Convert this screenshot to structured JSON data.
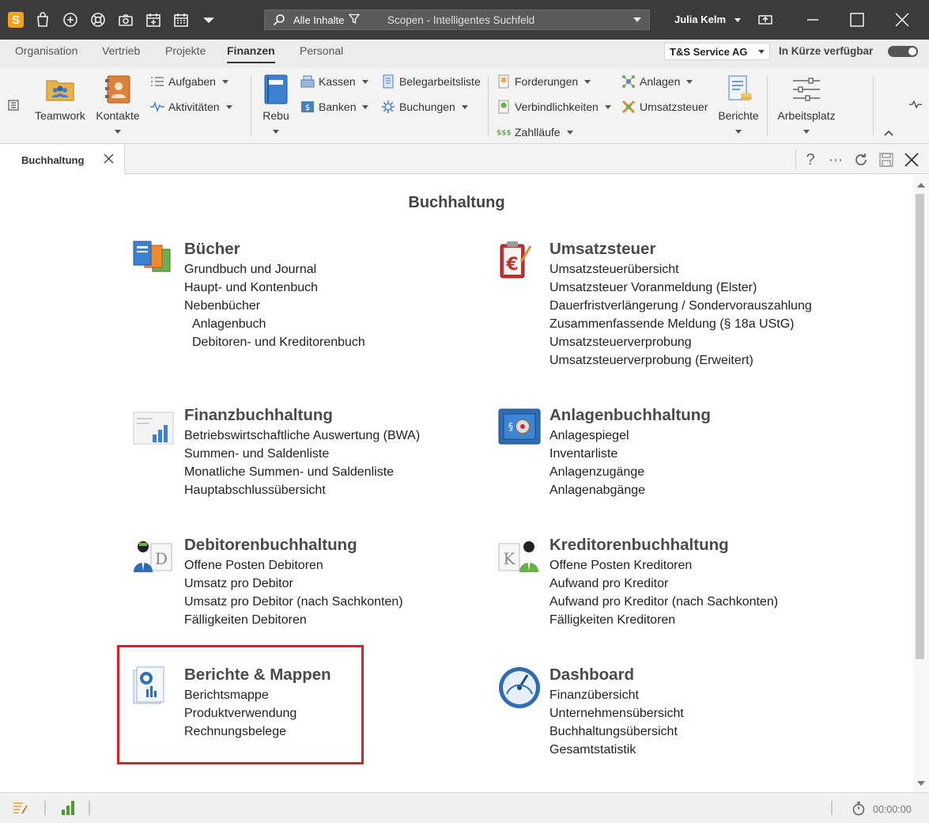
{
  "titlebar": {
    "logo_letter": "S",
    "search_scope": "Alle Inhalte",
    "search_placeholder": "Scopen - Intelligentes Suchfeld",
    "username": "Julia Kelm"
  },
  "modnav": {
    "tabs": [
      "Organisation",
      "Vertrieb",
      "Projekte",
      "Finanzen",
      "Personal"
    ],
    "active": "Finanzen",
    "company": "T&S Service AG",
    "soon_label": "In Kürze verfügbar"
  },
  "ribbon": {
    "teamwork": "Teamwork",
    "kontakte": "Kontakte",
    "aufgaben": "Aufgaben",
    "aktivitaeten": "Aktivitäten",
    "rebu": "Rebu",
    "kassen": "Kassen",
    "banken": "Banken",
    "belegarbeitsliste": "Belegarbeitsliste",
    "buchungen": "Buchungen",
    "forderungen": "Forderungen",
    "verbindlichkeiten": "Verbindlichkeiten",
    "zahllaeufe": "Zahlläufe",
    "anlagen": "Anlagen",
    "umsatzsteuer": "Umsatzsteuer",
    "berichte": "Berichte",
    "arbeitsplatz": "Arbeitsplatz"
  },
  "doctab": {
    "label": "Buchhaltung",
    "help": "?",
    "more": "⋯"
  },
  "page": {
    "title": "Buchhaltung",
    "sections": {
      "buecher": {
        "title": "Bücher",
        "items": [
          "Grundbuch und Journal",
          "Haupt- und Kontenbuch",
          "Nebenbücher",
          "Anlagenbuch",
          "Debitoren- und Kreditorenbuch"
        ]
      },
      "umsatzsteuer": {
        "title": "Umsatzsteuer",
        "items": [
          "Umsatzsteuerübersicht",
          "Umsatzsteuer Voranmeldung (Elster)",
          "Dauerfristverlängerung / Sondervorauszahlung",
          "Zusammenfassende Meldung (§ 18a UStG)",
          "Umsatzsteuerverprobung",
          "Umsatzsteuerverprobung (Erweitert)"
        ]
      },
      "finanzbuchhaltung": {
        "title": "Finanzbuchhaltung",
        "items": [
          "Betriebswirtschaftliche Auswertung (BWA)",
          "Summen- und Saldenliste",
          "Monatliche Summen- und Saldenliste",
          "Hauptabschlussübersicht"
        ]
      },
      "anlagenbuchhaltung": {
        "title": "Anlagenbuchhaltung",
        "items": [
          "Anlagespiegel",
          "Inventarliste",
          "Anlagenzugänge",
          "Anlagenabgänge"
        ]
      },
      "debitoren": {
        "title": "Debitorenbuchhaltung",
        "items": [
          "Offene Posten Debitoren",
          "Umsatz pro Debitor",
          "Umsatz pro Debitor (nach Sachkonten)",
          "Fälligkeiten Debitoren"
        ]
      },
      "kreditoren": {
        "title": "Kreditorenbuchhaltung",
        "items": [
          "Offene Posten Kreditoren",
          "Aufwand pro Kreditor",
          "Aufwand pro Kreditor (nach Sachkonten)",
          "Fälligkeiten Kreditoren"
        ]
      },
      "berichte": {
        "title": "Berichte & Mappen",
        "items": [
          "Berichtsmappe",
          "Produktverwendung",
          "Rechnungsbelege"
        ]
      },
      "dashboard": {
        "title": "Dashboard",
        "items": [
          "Finanzübersicht",
          "Unternehmensübersicht",
          "Buchhaltungsübersicht",
          "Gesamtstatistik"
        ]
      }
    }
  },
  "status": {
    "timer": "00:00:00"
  },
  "colors": {
    "titlebar": "#3b3b3b",
    "logo": "#f5a21b",
    "highlight": "#e02020"
  }
}
